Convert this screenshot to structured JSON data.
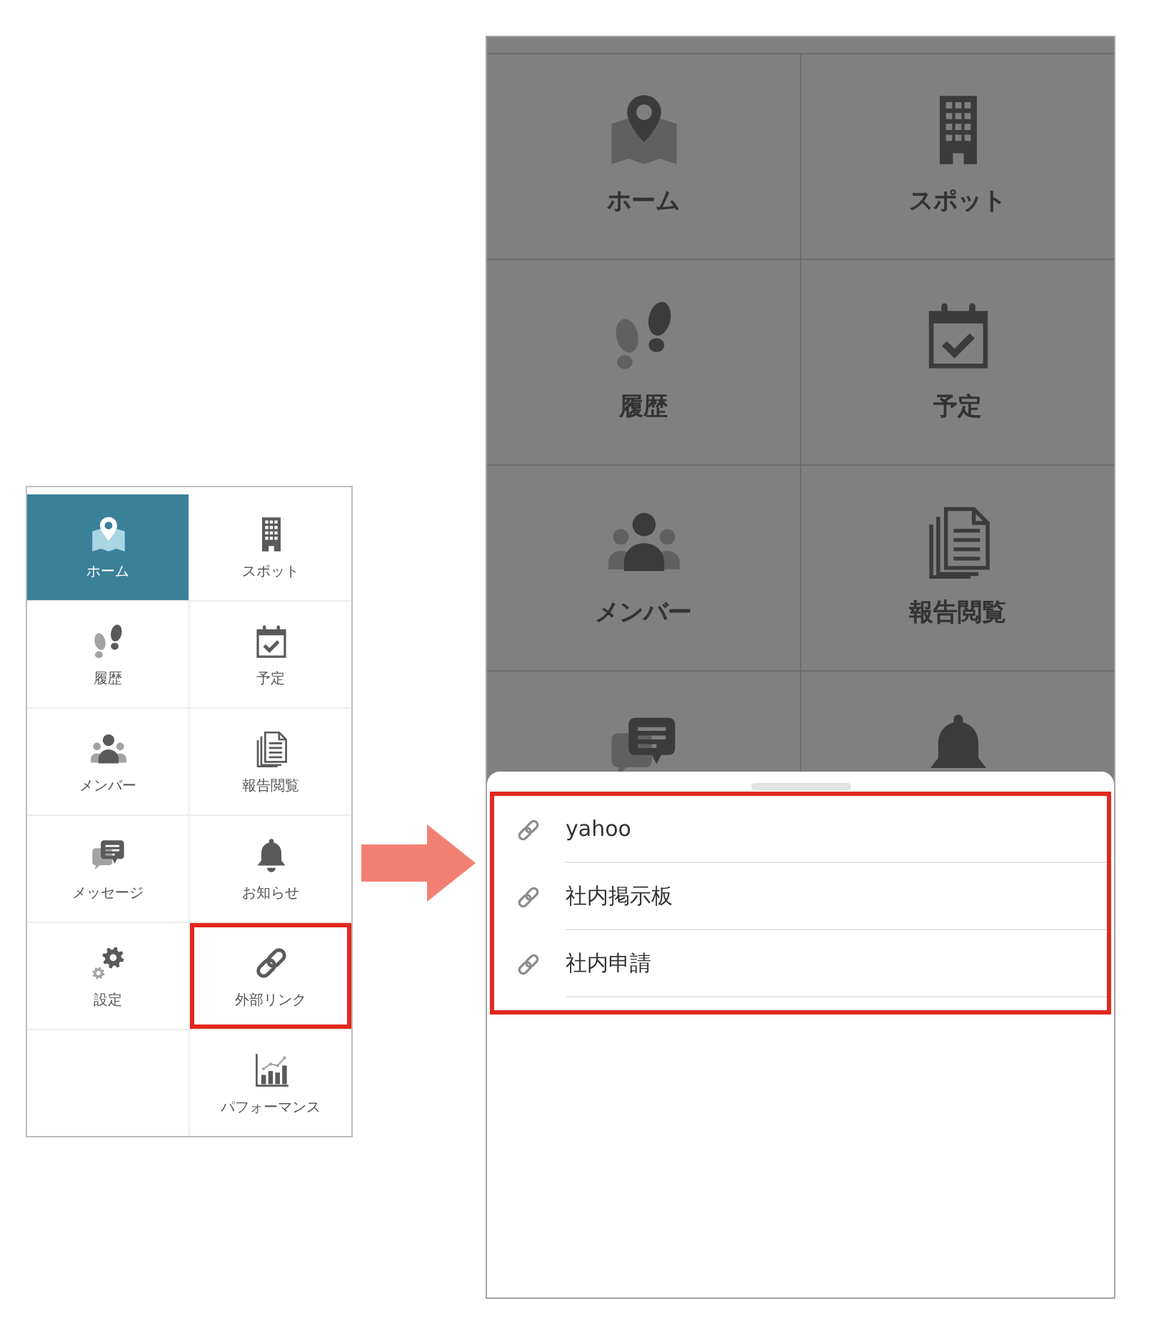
{
  "menu_panel": {
    "tiles": [
      {
        "kind": "menu",
        "label": "ホーム",
        "selected": true,
        "highlighted": false
      },
      {
        "kind": "menu",
        "label": "スポット",
        "selected": false,
        "highlighted": false
      },
      {
        "kind": "menu",
        "label": "履歴",
        "selected": false,
        "highlighted": false
      },
      {
        "kind": "menu",
        "label": "予定",
        "selected": false,
        "highlighted": false
      },
      {
        "kind": "menu",
        "label": "メンバー",
        "selected": false,
        "highlighted": false
      },
      {
        "kind": "menu",
        "label": "報告閲覧",
        "selected": false,
        "highlighted": false
      },
      {
        "kind": "menu",
        "label": "メッセージ",
        "selected": false,
        "highlighted": false
      },
      {
        "kind": "menu",
        "label": "お知らせ",
        "selected": false,
        "highlighted": false
      },
      {
        "kind": "menu",
        "label": "設定",
        "selected": false,
        "highlighted": false
      },
      {
        "kind": "menu",
        "label": "外部リンク",
        "selected": false,
        "highlighted": true
      },
      {
        "kind": "empty"
      },
      {
        "kind": "menu",
        "label": "パフォーマンス",
        "selected": false,
        "highlighted": false
      }
    ]
  },
  "phone_screen": {
    "dimmed": true,
    "menu_tiles": [
      {
        "kind": "menu",
        "label": "ホーム"
      },
      {
        "kind": "menu",
        "label": "スポット"
      },
      {
        "kind": "menu",
        "label": "履歴"
      },
      {
        "kind": "menu",
        "label": "予定"
      },
      {
        "kind": "menu",
        "label": "メンバー"
      },
      {
        "kind": "menu",
        "label": "報告閲覧"
      },
      {
        "kind": "covered"
      },
      {
        "kind": "covered"
      }
    ],
    "link_sheet": {
      "highlighted": true,
      "links": [
        {
          "label": "yahoo"
        },
        {
          "label": "社内掲示板"
        },
        {
          "label": "社内申請"
        }
      ]
    }
  }
}
